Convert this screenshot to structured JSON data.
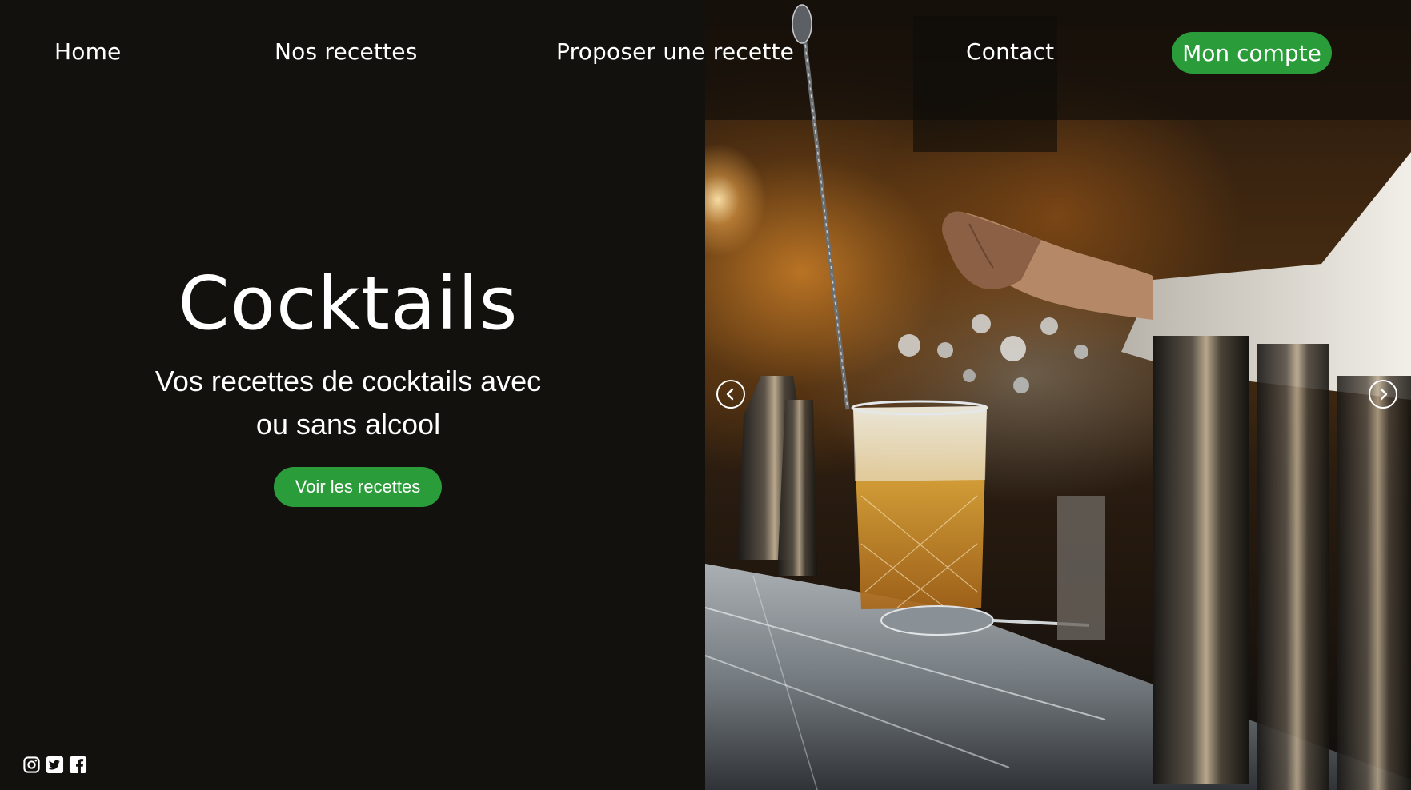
{
  "nav": {
    "home": "Home",
    "recipes": "Nos recettes",
    "propose": "Proposer une recette",
    "contact": "Contact",
    "account": "Mon compte"
  },
  "hero": {
    "title": "Cocktails",
    "subtitle_line1": "Vos recettes de cocktails avec",
    "subtitle_line2": "ou sans alcool",
    "cta_label": "Voir les recettes",
    "image_subject": "bartender stirring a cocktail in a mixing glass on a bar counter"
  },
  "carousel": {
    "prev_icon": "chevron-left-icon",
    "next_icon": "chevron-right-icon"
  },
  "social": {
    "icons": [
      "instagram-icon",
      "twitter-icon",
      "facebook-icon"
    ]
  },
  "colors": {
    "background": "#12110e",
    "accent": "#2a9c3a",
    "text": "#ffffff"
  }
}
